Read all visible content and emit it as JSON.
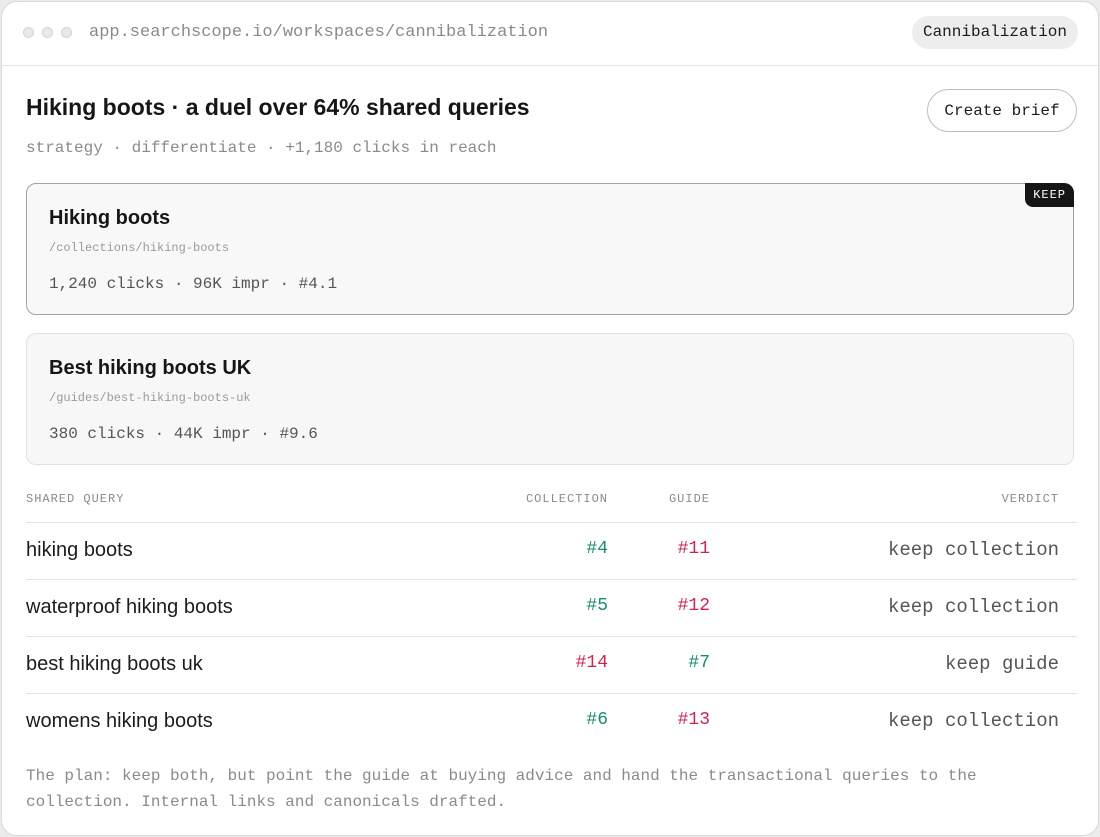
{
  "browser": {
    "url": "app.searchscope.io/workspaces/cannibalization",
    "tab_pill": "Cannibalization"
  },
  "header": {
    "title": "Hiking boots · a duel over 64% shared queries",
    "subtitle": "strategy · differentiate · +1,180 clicks in reach",
    "create_brief_label": "Create brief"
  },
  "pages": [
    {
      "title": "Hiking boots",
      "path": "/collections/hiking-boots",
      "stats": "1,240 clicks · 96K impr · #4.1",
      "badge": "KEEP"
    },
    {
      "title": "Best hiking boots UK",
      "path": "/guides/best-hiking-boots-uk",
      "stats": "380 clicks · 44K impr · #9.6"
    }
  ],
  "table": {
    "headers": {
      "query": "SHARED QUERY",
      "collection": "COLLECTION",
      "guide": "GUIDE",
      "verdict": "VERDICT"
    },
    "rows": [
      {
        "query": "hiking boots",
        "collection": "#4",
        "guide": "#11",
        "verdict": "keep collection",
        "winner": "collection"
      },
      {
        "query": "waterproof hiking boots",
        "collection": "#5",
        "guide": "#12",
        "verdict": "keep collection",
        "winner": "collection"
      },
      {
        "query": "best hiking boots uk",
        "collection": "#14",
        "guide": "#7",
        "verdict": "keep guide",
        "winner": "guide"
      },
      {
        "query": "womens hiking boots",
        "collection": "#6",
        "guide": "#13",
        "verdict": "keep collection",
        "winner": "collection"
      }
    ]
  },
  "note": "The plan: keep both, but point the guide at buying advice and hand the transactional queries to the collection. Internal links and canonicals drafted.",
  "colors": {
    "win": "#1a8a6e",
    "lose": "#c8264f"
  }
}
